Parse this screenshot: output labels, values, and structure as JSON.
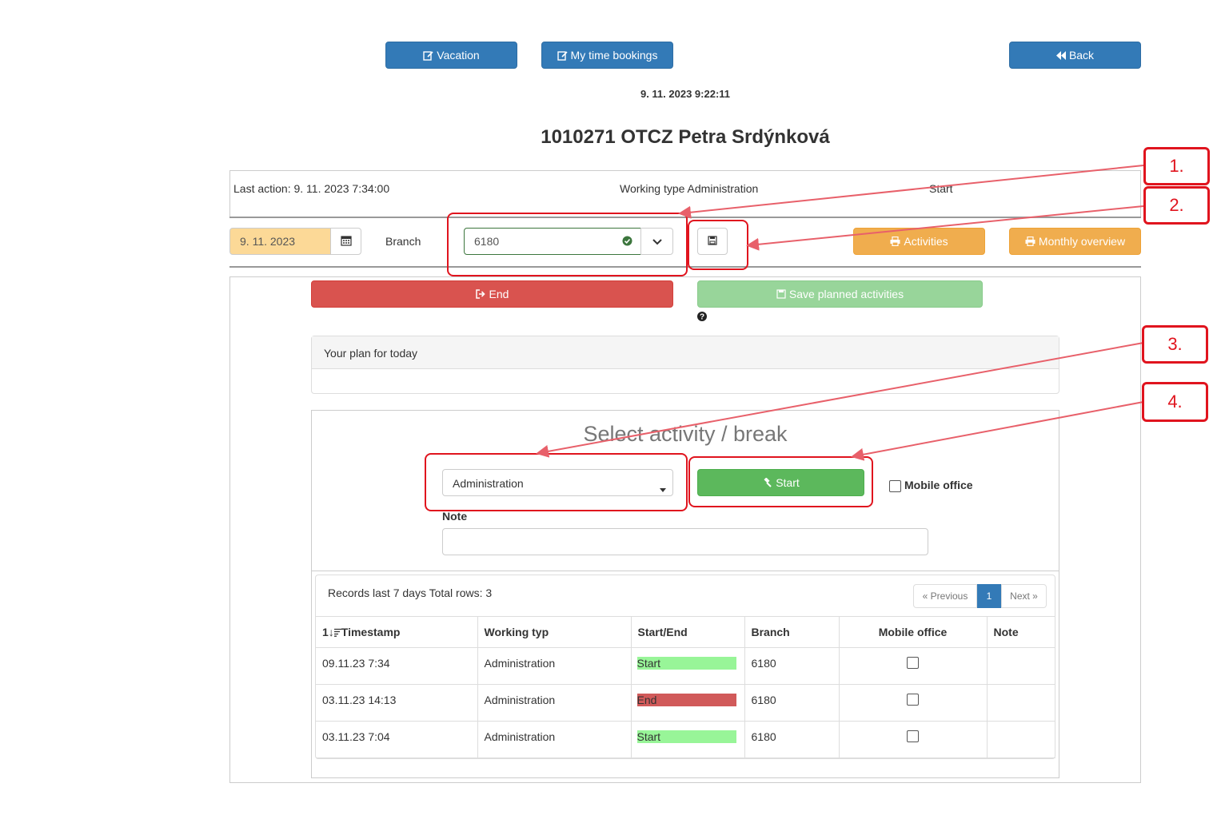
{
  "top_buttons": {
    "vacation": "Vacation",
    "my_time_bookings": "My time bookings",
    "back": "Back"
  },
  "datetime": "9. 11. 2023 9:22:11",
  "employee_title": "1010271 OTCZ Petra Srdýnková",
  "status_bar": {
    "last_action": "Last action: 9. 11. 2023 7:34:00",
    "working_type": "Working type Administration",
    "state": "Start"
  },
  "toolbar": {
    "date_value": "9. 11. 2023",
    "branch_label": "Branch",
    "branch_value": "6180",
    "activities": "Activities",
    "monthly_overview": "Monthly overview"
  },
  "actions": {
    "end": "End",
    "save_planned": "Save planned activities"
  },
  "plan": {
    "header": "Your plan for today"
  },
  "select": {
    "title": "Select activity / break",
    "activity_value": "Administration",
    "start": "Start",
    "mobile_office": "Mobile office",
    "note_label": "Note"
  },
  "records": {
    "title": "Records last 7 days Total rows: 3",
    "pagination": {
      "previous": "« Previous",
      "page": "1",
      "next": "Next »"
    },
    "headers": [
      "Timestamp",
      "Working typ",
      "Start/End",
      "Branch",
      "Mobile office",
      "Note"
    ],
    "sort_icon_text": "1↓",
    "rows": [
      {
        "timestamp": "09.11.23 7:34",
        "working_type": "Administration",
        "status": "Start",
        "branch": "6180",
        "note": ""
      },
      {
        "timestamp": "03.11.23 14:13",
        "working_type": "Administration",
        "status": "End",
        "branch": "6180",
        "note": ""
      },
      {
        "timestamp": "03.11.23 7:04",
        "working_type": "Administration",
        "status": "Start",
        "branch": "6180",
        "note": ""
      }
    ]
  },
  "callouts": [
    "1.",
    "2.",
    "3.",
    "4."
  ],
  "colors": {
    "primary": "#337ab7",
    "warning": "#f0ad4e",
    "danger": "#d9534f",
    "success": "#5cb85c",
    "annotation": "#e0141e"
  }
}
